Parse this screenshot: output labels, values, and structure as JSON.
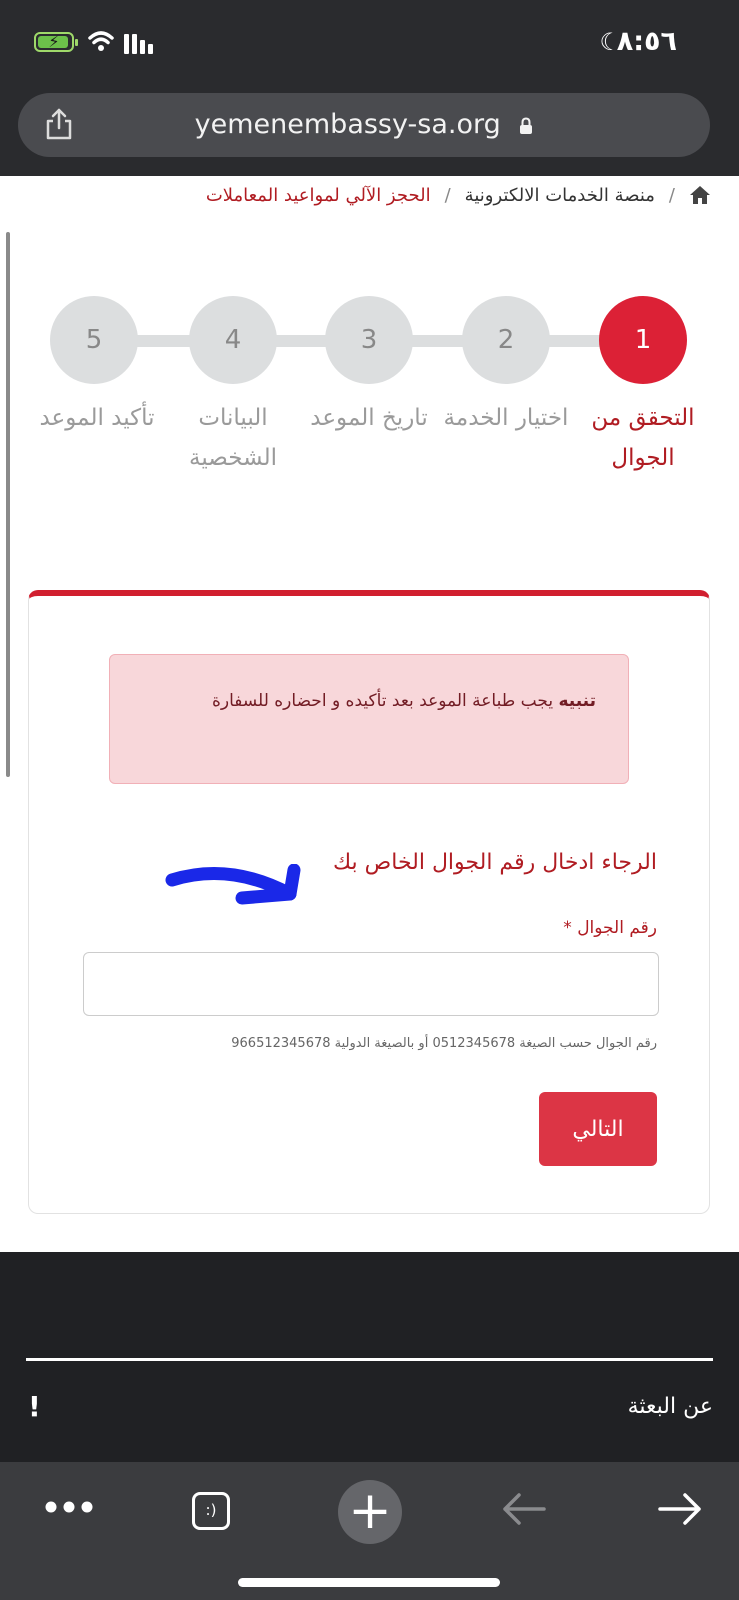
{
  "status_bar": {
    "time": "٨:٥٦"
  },
  "browser": {
    "url": "yemenembassy-sa.org"
  },
  "breadcrumb": {
    "item1": "منصة الخدمات الالكترونية",
    "current": "الحجز الآلي لمواعيد المعاملات"
  },
  "steps": [
    {
      "number": "1",
      "label": "التحقق من الجوال"
    },
    {
      "number": "2",
      "label": "اختيار الخدمة"
    },
    {
      "number": "3",
      "label": "تاريخ الموعد"
    },
    {
      "number": "4",
      "label": "البيانات الشخصية"
    },
    {
      "number": "5",
      "label": "تأكيد الموعد"
    }
  ],
  "alert": {
    "title": "تنبيه",
    "text": "يجب طباعة الموعد بعد تأكيده و احضاره للسفارة"
  },
  "form": {
    "heading": "الرجاء ادخال رقم الجوال الخاص بك",
    "phone_label": "رقم الجوال *",
    "phone_value": "",
    "hint": "رقم الجوال حسب الصيغة 0512345678 أو بالصيغة الدولية 966512345678",
    "next_button": "التالي"
  },
  "footer": {
    "about": "عن البعثة",
    "alert_symbol": "!"
  },
  "toolbar": {
    "tabs_label": ":)",
    "new_tab": "+"
  },
  "colors": {
    "brand_red": "#dc2136",
    "text_red": "#b01c22",
    "alert_bg": "#f8d7da",
    "footer_bg": "#202124"
  }
}
